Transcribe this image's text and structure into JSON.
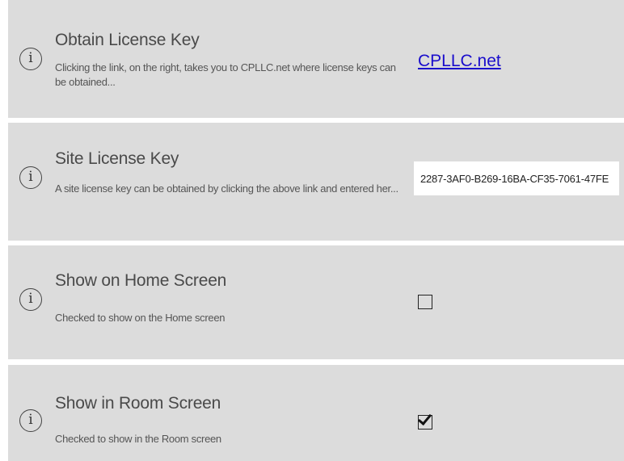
{
  "settings": [
    {
      "title": "Obtain License Key",
      "description": "Clicking the link, on the right, takes you to CPLLC.net where license keys can be obtained...",
      "link_text": "CPLLC.net"
    },
    {
      "title": "Site License Key",
      "description": "A site license key can be obtained by clicking the above link and entered her...",
      "value": "2287-3AF0-B269-16BA-CF35-7061-47FE"
    },
    {
      "title": "Show on Home Screen",
      "description": "Checked to show on the Home screen",
      "checked": false
    },
    {
      "title": "Show in Room Screen",
      "description": "Checked to show in the Room screen",
      "checked": true
    }
  ],
  "icons": {
    "info": "info-circle-icon"
  }
}
